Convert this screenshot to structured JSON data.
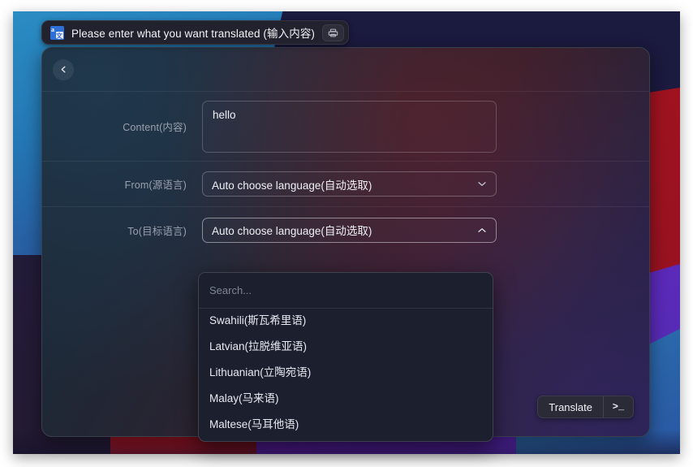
{
  "window": {
    "titlebar": {
      "app_icon": "translate-icon",
      "title": "Please enter what you want translated (输入内容)",
      "action_icon": "printer-icon"
    },
    "header": {
      "back_icon": "chevron-left-icon"
    }
  },
  "form": {
    "rows": [
      {
        "label": "Content(内容)",
        "type": "textarea",
        "value": "hello"
      },
      {
        "label": "From(源语言)",
        "type": "select",
        "value": "Auto choose language(自动选取)",
        "arrow_icon": "chevron-down-icon",
        "open": false
      },
      {
        "label": "To(目标语言)",
        "type": "select",
        "value": "Auto choose language(自动选取)",
        "arrow_icon": "chevron-up-icon",
        "open": true
      }
    ]
  },
  "dropdown": {
    "search_placeholder": "Search...",
    "items": [
      {
        "label": "",
        "clipped": true
      },
      {
        "label": "Swahili(斯瓦希里语)",
        "clipped": false
      },
      {
        "label": "Latvian(拉脱维亚语)",
        "clipped": false
      },
      {
        "label": "Lithuanian(立陶宛语)",
        "clipped": false
      },
      {
        "label": "Malay(马来语)",
        "clipped": false
      },
      {
        "label": "Maltese(马耳他语)",
        "clipped": false
      }
    ]
  },
  "actions": {
    "translate_label": "Translate",
    "terminal_glyph": ">_",
    "terminal_icon": "terminal-icon"
  },
  "colors": {
    "accent_blue": "#2f6fd8",
    "card_border": "#3a3f4c",
    "titlebar_bg": "#22222e",
    "dropdown_bg": "#1c1f2e",
    "text_primary": "#eef0f5",
    "text_muted": "#9aa0ae"
  }
}
